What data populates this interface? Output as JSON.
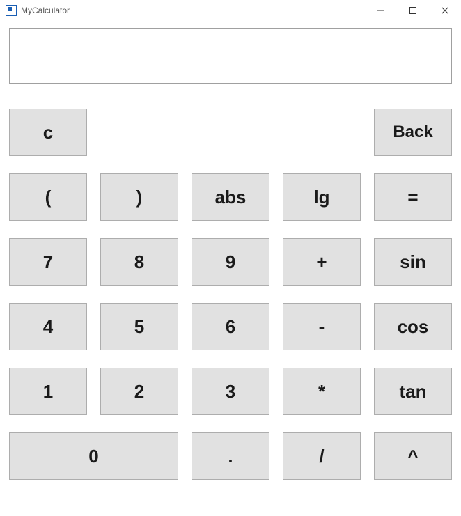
{
  "window": {
    "title": "MyCalculator"
  },
  "display": {
    "value": ""
  },
  "buttons": {
    "clear": "c",
    "back": "Back",
    "lparen": "(",
    "rparen": ")",
    "abs": "abs",
    "lg": "lg",
    "equals": "=",
    "d7": "7",
    "d8": "8",
    "d9": "9",
    "plus": "+",
    "sin": "sin",
    "d4": "4",
    "d5": "5",
    "d6": "6",
    "minus": "-",
    "cos": "cos",
    "d1": "1",
    "d2": "2",
    "d3": "3",
    "multiply": "*",
    "tan": "tan",
    "d0": "0",
    "dot": ".",
    "divide": "/",
    "power": "^"
  }
}
